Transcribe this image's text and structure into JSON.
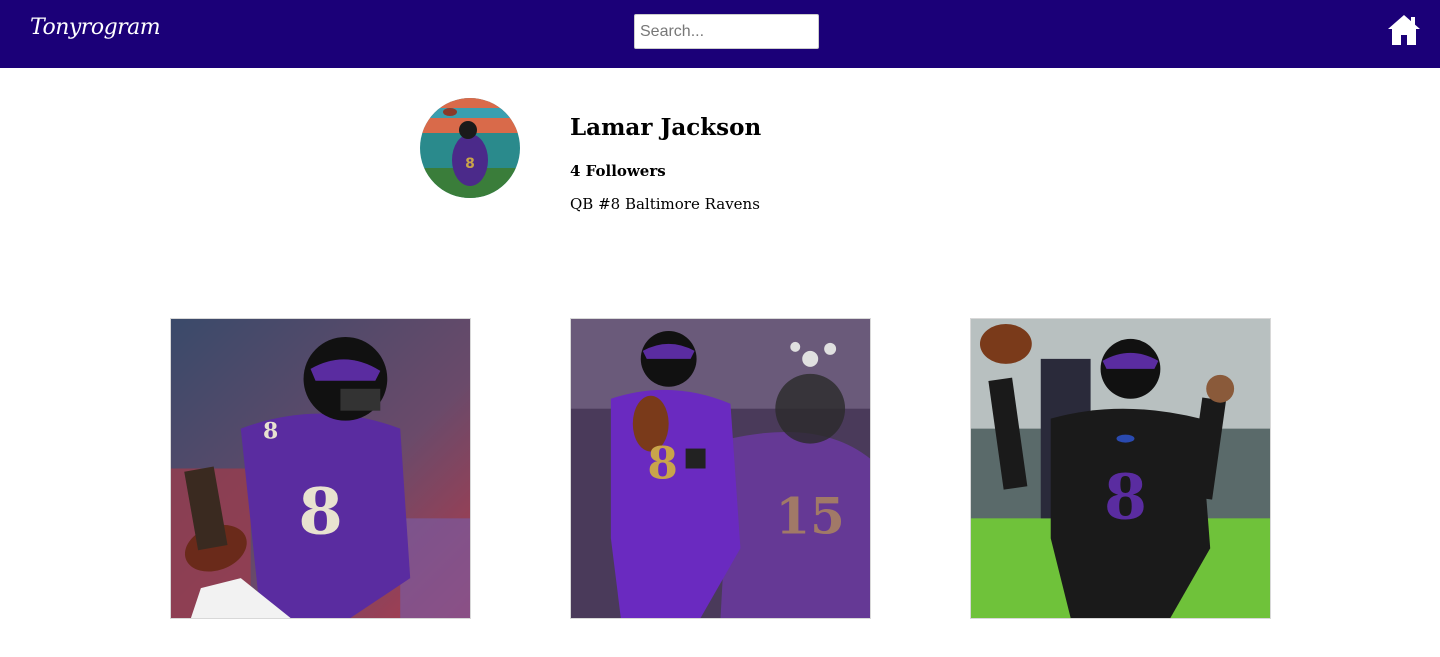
{
  "nav": {
    "brand": "Tonyrogram",
    "search_placeholder": "Search...",
    "home_icon": "home-icon",
    "bg_color": "#1b0078"
  },
  "profile": {
    "name": "Lamar Jackson",
    "followers": "4 Followers",
    "bio": "QB #8 Baltimore Ravens",
    "avatar_icon": "profile-photo"
  },
  "posts": [
    {
      "id": "post-1",
      "image": "player-purple-jersey-8-running"
    },
    {
      "id": "post-2",
      "image": "player-purple-jersey-8-holding-ball"
    },
    {
      "id": "post-3",
      "image": "player-black-jersey-8-throwing"
    }
  ],
  "colors": {
    "ravens_purple": "#5a2ca0",
    "ravens_black": "#1a1a1a",
    "gold": "#c9a44a",
    "field_green": "#6fc23a"
  }
}
